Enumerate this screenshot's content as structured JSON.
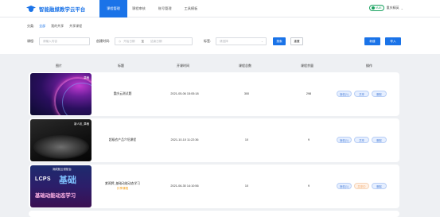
{
  "header": {
    "logo_text": "智能融媒教学云平台",
    "nav": [
      "课程管理",
      "课程审核",
      "账号管理",
      "工具模板"
    ],
    "vip_badge": "VUE",
    "user_name": "重庆精英"
  },
  "filters": {
    "category_label": "分类:",
    "category_options": [
      "全部",
      "我的共享",
      "共享课程"
    ],
    "course_label": "课程:",
    "course_placeholder": "请输入内容",
    "created_label": "创建时间:",
    "start_placeholder": "开始日期",
    "range_sep": "至",
    "end_placeholder": "结束日期",
    "tag_label": "标签:",
    "tag_placeholder": "请选择",
    "search_button": "搜索",
    "reset_button": "重置",
    "create_button": "新建",
    "import_button": "导入"
  },
  "table": {
    "columns": [
      "图片",
      "标题",
      "开课时间",
      "课程总数",
      "课程余量",
      "操作"
    ],
    "rows": [
      {
        "thumb_tag": "草稿",
        "title": "重庆云测试题",
        "subtitle": "",
        "start_time": "2021-05-06 15:05:18",
        "total": "300",
        "remaining": "298",
        "actions": [
          "授权(1)",
          "共享",
          "删除"
        ]
      },
      {
        "thumb_tag": "新人彩_草稿",
        "title": "超级农产品介绍课程",
        "subtitle": "",
        "start_time": "2021-10-10 11:22:36",
        "total": "10",
        "remaining": "9",
        "actions": [
          "授权(1)",
          "共享",
          "删除"
        ]
      },
      {
        "thumb_tag": "",
        "thumb_brand": "润成航云领航台",
        "thumb_big": "LCPS",
        "thumb_big2": "基础",
        "thumb_sub": "基础动能动态学习",
        "title": "紫鸦牌_基础动能动态学习",
        "subtitle": "共享课程",
        "start_time": "2021-06-30 14:10:56",
        "total": "10",
        "remaining": "9",
        "actions": [
          "授权(1)",
          "共享中",
          "删除"
        ]
      }
    ]
  }
}
